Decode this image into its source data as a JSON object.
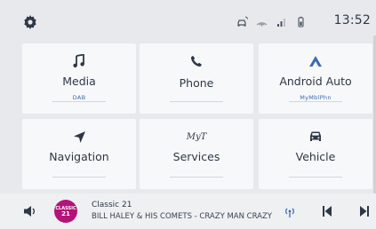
{
  "status_bar": {
    "time": "13:52"
  },
  "tiles": [
    {
      "label": "Media",
      "sub": "DAB",
      "icon": "music-note-icon"
    },
    {
      "label": "Phone",
      "sub": "",
      "icon": "phone-icon"
    },
    {
      "label": "Android Auto",
      "sub": "MyMblPhn",
      "icon": "android-auto-icon"
    },
    {
      "label": "Navigation",
      "sub": "",
      "icon": "navigation-arrow-icon"
    },
    {
      "label": "Services",
      "sub": "",
      "icon": "services-logo-icon"
    },
    {
      "label": "Vehicle",
      "sub": "",
      "icon": "car-icon"
    }
  ],
  "services_logo_text": "MyT",
  "now_playing": {
    "station": "Classic 21",
    "track": "BILL HALEY & HIS COMETS - CRAZY MAN CRAZY",
    "logo_text_top": "CLASSIC",
    "logo_text_bottom": "21"
  },
  "colors": {
    "accent": "#3b6bb0",
    "station_logo": "#b4137a"
  }
}
